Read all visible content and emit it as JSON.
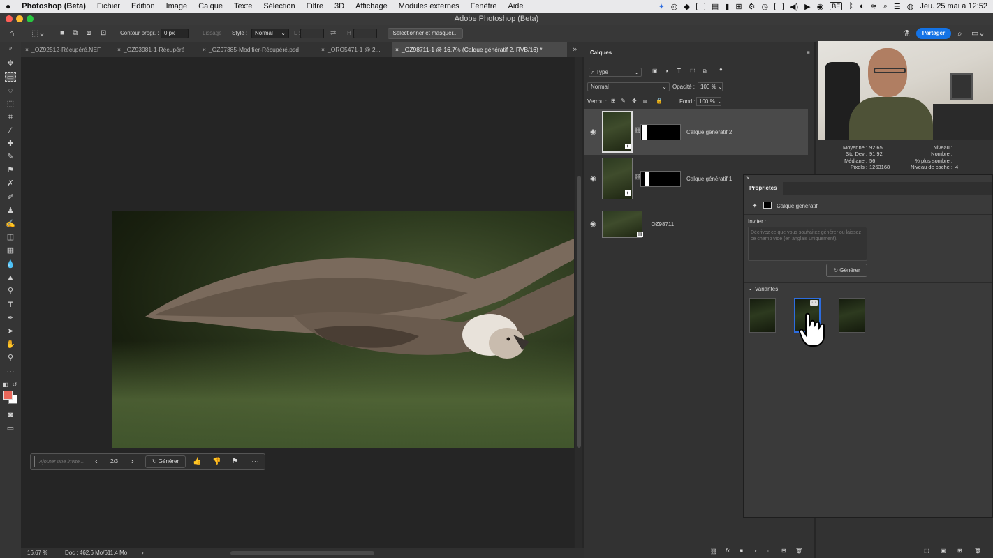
{
  "menubar": {
    "app_name": "Photoshop (Beta)",
    "items": [
      "Fichier",
      "Edition",
      "Image",
      "Calque",
      "Texte",
      "Sélection",
      "Filtre",
      "3D",
      "Affichage",
      "Modules externes",
      "Fenêtre",
      "Aide"
    ],
    "lang": "BE",
    "datetime": "Jeu. 25 mai à 12:52"
  },
  "window": {
    "title": "Adobe Photoshop (Beta)"
  },
  "options": {
    "contour_label": "Contour progr. :",
    "contour_value": "0 px",
    "lissage_label": "Lissage",
    "style_label": "Style :",
    "style_value": "Normal",
    "l_label": "L :",
    "h_label": "H :",
    "select_mask_button": "Sélectionner et masquer...",
    "share_button": "Partager"
  },
  "tabs": [
    "_OZ92512-Récupéré.NEF",
    "_OZ93981-1-Récupéré",
    "_OZ97385-Modifier-Récupéré.psd",
    "_ORO5471-1 @ 2...",
    "_OZ98711-1 @ 16,7% (Calque génératif 2, RVB/16) *"
  ],
  "generative_bar": {
    "placeholder": "Ajouter une invite...",
    "counter": "2/3",
    "generate_label": "Générer"
  },
  "status": {
    "zoom": "16,67 %",
    "doc": "Doc : 462,6 Mo/611,4 Mo"
  },
  "layers_panel": {
    "title": "Calques",
    "filter_label": "Type",
    "blend_mode": "Normal",
    "opacity_label": "Opacité :",
    "opacity_value": "100 %",
    "lock_label": "Verrou :",
    "fill_label": "Fond :",
    "fill_value": "100 %",
    "layers": [
      {
        "name": "Calque génératif 2",
        "selected": true
      },
      {
        "name": "Calque génératif 1",
        "selected": false
      },
      {
        "name": "_OZ98711",
        "selected": false
      }
    ]
  },
  "histogram": {
    "moyenne_label": "Moyenne :",
    "moyenne": "92,65",
    "stddev_label": "Std Dev :",
    "stddev": "91,92",
    "mediane_label": "Médiane :",
    "mediane": "56",
    "pixels_label": "Pixels :",
    "pixels": "1263168",
    "niveau_label": "Niveau :",
    "nombre_label": "Nombre :",
    "sombre_label": "% plus sombre :",
    "cache_label": "Niveau de cache :",
    "cache": "4"
  },
  "properties_panel": {
    "title": "Propriétés",
    "layer_type": "Calque génératif",
    "prompt_label": "Inviter :",
    "prompt_placeholder": "Décrivez ce que vous souhaitez générer ou laissez ce champ vide (en anglais uniquement).",
    "generate_button": "Générer",
    "variants_label": "Variantes"
  },
  "colors": {
    "foreground": "#e8675a",
    "background": "#ffffff",
    "share_blue": "#1473e6",
    "variant_selected": "#2d6cdf"
  }
}
